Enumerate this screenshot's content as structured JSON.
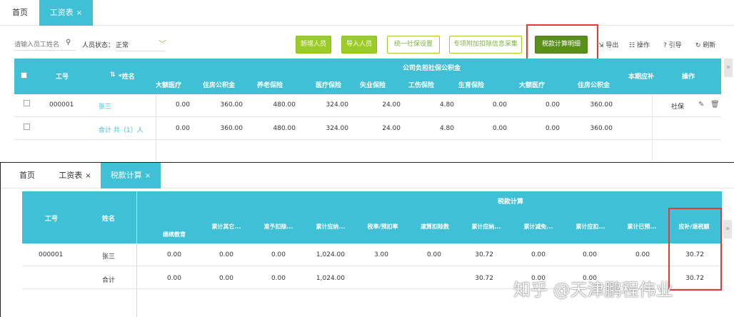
{
  "top": {
    "tabs": [
      {
        "label": "首页"
      },
      {
        "label": "工资表",
        "close": "×"
      }
    ],
    "search_placeholder": "请输入员工姓名",
    "status_label": "人员状态：",
    "status_value": "正常",
    "buttons": {
      "new_person": "新增人员",
      "import_person": "导入人员",
      "social_setting": "统一社保设置",
      "special_deduction": "专项附加扣除信息采集",
      "tax_detail": "税款计算明细"
    },
    "tools": {
      "export": "导出",
      "operate": "操作",
      "guide": "引导",
      "refresh": "刷新"
    },
    "table": {
      "col_id": "工号",
      "col_name": "*姓名",
      "group_company": "公司负担社保公积金",
      "col_current": "本期应补",
      "col_action": "操作",
      "sub_headers": [
        "大额医疗",
        "住房公积金",
        "养老保险",
        "医疗保险",
        "失业保险",
        "工伤保险",
        "生育保险",
        "大额医疗",
        "住房公积金"
      ],
      "rows": [
        {
          "id": "000001",
          "name": "张三",
          "values": [
            "0.00",
            "360.00",
            "480.00",
            "324.00",
            "24.00",
            "4.80",
            "0.00",
            "0.00",
            "360.00"
          ],
          "action": "社保"
        },
        {
          "id": "",
          "name": "合计 共（1）人",
          "values": [
            "0.00",
            "360.00",
            "480.00",
            "324.00",
            "24.00",
            "4.80",
            "0.00",
            "0.00",
            "360.00"
          ],
          "action": ""
        }
      ]
    }
  },
  "bottom": {
    "tabs": [
      {
        "label": "首页"
      },
      {
        "label": "工资表",
        "close": "×"
      },
      {
        "label": "税款计算",
        "close": "×"
      }
    ],
    "table": {
      "col_id": "工号",
      "col_name": "姓名",
      "group_tax": "税款计算",
      "sub_headers": [
        "继续教育",
        "累计其它...",
        "准予扣除...",
        "累计应纳...",
        "税率/预扣率",
        "速算扣除数",
        "累计应纳...",
        "累计减免...",
        "累计应扣...",
        "累计已预...",
        "应补/退税额"
      ],
      "rows": [
        {
          "id": "000001",
          "name": "张三",
          "values": [
            "0.00",
            "0.00",
            "0.00",
            "1,024.00",
            "3.00",
            "0.00",
            "30.72",
            "0.00",
            "0.00",
            "0.00",
            "30.72"
          ]
        },
        {
          "id": "",
          "name": "合计",
          "values": [
            "0.00",
            "0.00",
            "0.00",
            "1,024.00",
            "",
            "",
            "30.72",
            "0.00",
            "0.00",
            "",
            "30.72"
          ]
        }
      ]
    },
    "watermark": "知乎 @天津鹏程伟业"
  }
}
